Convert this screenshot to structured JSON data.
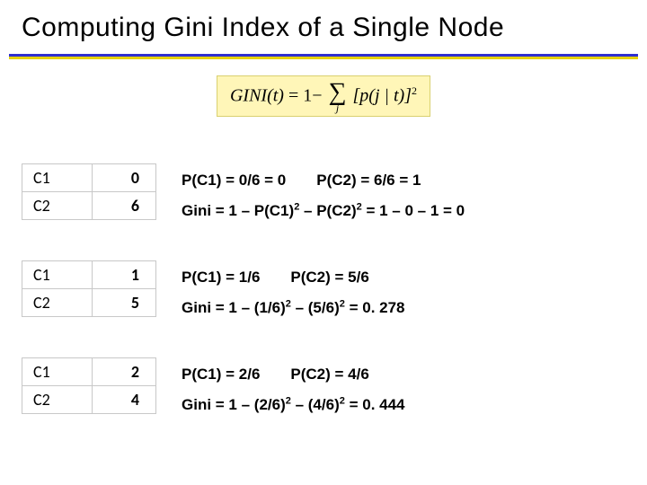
{
  "title": "Computing Gini Index of a Single Node",
  "formula": {
    "lhs": "GINI(t)",
    "eq": "=",
    "one_minus": "1−",
    "sigma_sub": "j",
    "inside": "[p(j | t)]",
    "exp": "2"
  },
  "examples": [
    {
      "rows": [
        {
          "label": "C1",
          "value": "0"
        },
        {
          "label": "C2",
          "value": "6"
        }
      ],
      "pc1": "P(C1) = 0/6 = 0",
      "pc2": "P(C2) = 6/6 = 1",
      "gini_prefix": "Gini = 1 – P(C1)",
      "gini_mid": " – P(C2)",
      "gini_tail": " = 1 – 0 – 1 = 0"
    },
    {
      "rows": [
        {
          "label": "C1",
          "value": "1"
        },
        {
          "label": "C2",
          "value": "5"
        }
      ],
      "pc1": "P(C1) = 1/6",
      "pc2": "P(C2) = 5/6",
      "gini_prefix": "Gini = 1 – (1/6)",
      "gini_mid": " – (5/6)",
      "gini_tail": " = 0. 278"
    },
    {
      "rows": [
        {
          "label": "C1",
          "value": "2"
        },
        {
          "label": "C2",
          "value": "4"
        }
      ],
      "pc1": "P(C1) = 2/6",
      "pc2": "P(C2) = 4/6",
      "gini_prefix": "Gini = 1 – (2/6)",
      "gini_mid": " – (4/6)",
      "gini_tail": " = 0. 444"
    }
  ]
}
